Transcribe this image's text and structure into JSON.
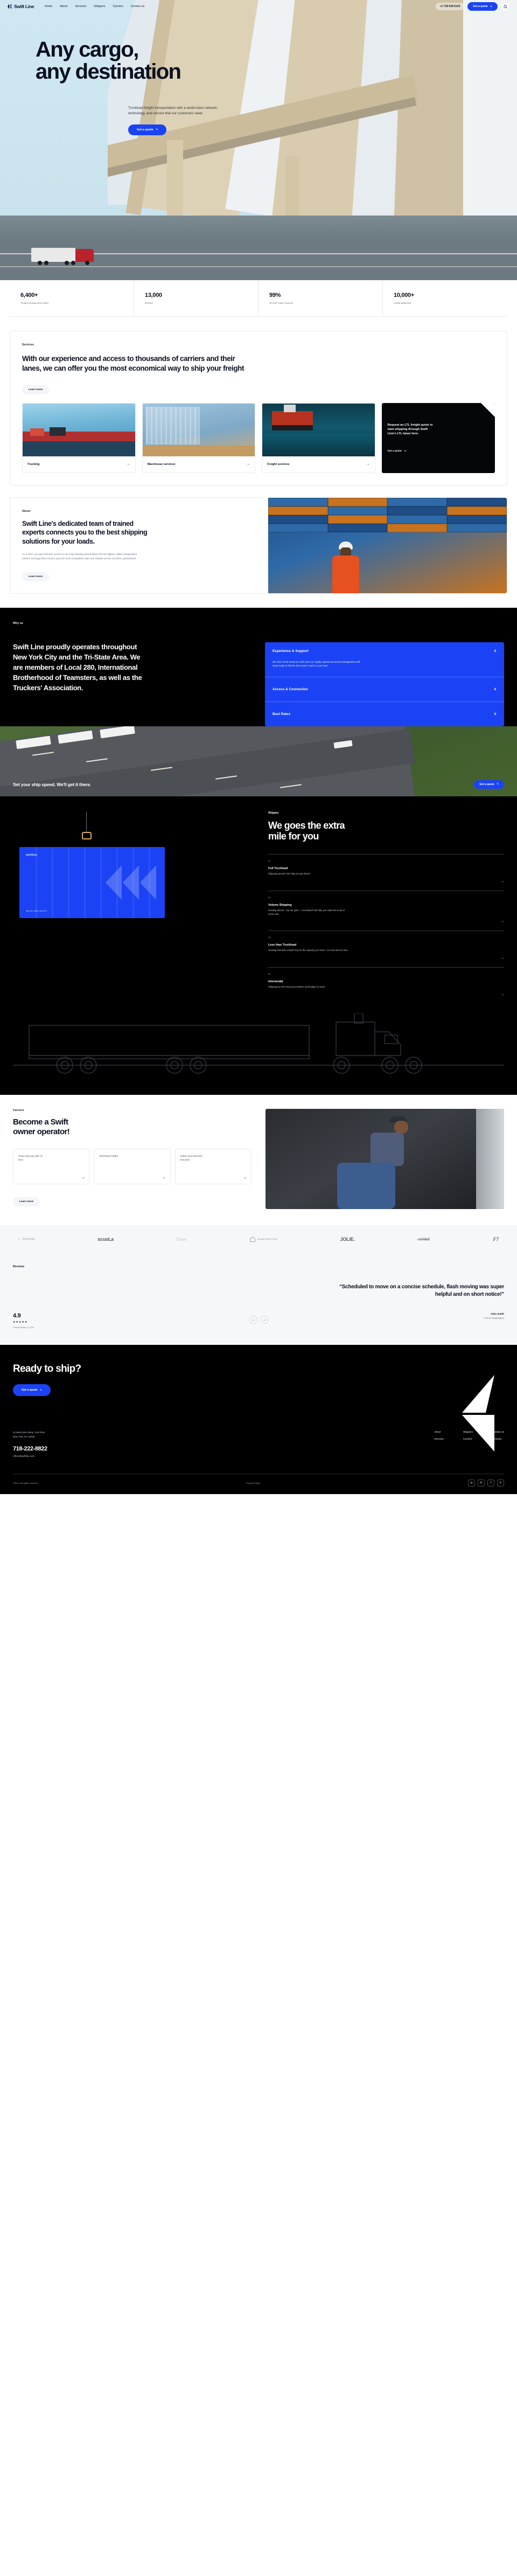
{
  "header": {
    "logo_text": "Swift Line",
    "nav": [
      {
        "label": "Home"
      },
      {
        "label": "About"
      },
      {
        "label": "Services"
      },
      {
        "label": "Shippers"
      },
      {
        "label": "Carriers"
      },
      {
        "label": "Contact us"
      }
    ],
    "phone": "+1 718 618 6133",
    "cta_label": "Get a quote",
    "cta_arrow": "↘",
    "search_icon": "search-icon"
  },
  "hero": {
    "title_line1": "Any cargo,",
    "title_line2": "any destination",
    "subtitle": "Truckload freight transportation with a world-class network, technology, and service that our customers need.",
    "cta_label": "Get a quote",
    "cta_arrow": "↘"
  },
  "stats": [
    {
      "value": "6,400+",
      "label": "Trailers produced in 2024"
    },
    {
      "value": "13,000",
      "label": "Drivers"
    },
    {
      "value": "99%",
      "label": "US ZIP code covered"
    },
    {
      "value": "10,000+",
      "label": "Loads delivered"
    }
  ],
  "services": {
    "eyebrow": "Services",
    "heading": "With our experience and access to thousands of carriers and their lanes, we can offer you the most economical way to ship your freight",
    "learn_more": "Learn more",
    "cards": [
      {
        "label": "Trucking",
        "arrow": "→"
      },
      {
        "label": "Warehouse services",
        "arrow": "→"
      },
      {
        "label": "Freight services",
        "arrow": "→"
      }
    ],
    "promo": {
      "text": "Request an LTL freight quote to start shipping through Swift Line's LTL lanes here.",
      "cta_label": "Get a quote",
      "cta_arrow": "↘"
    }
  },
  "about": {
    "eyebrow": "About",
    "heading": "Swift Line's dedicated team of trained experts connects you to the best shipping solutions for your loads.",
    "body": "As a client, you get exclusive access to our long-standing partnerships with the highest caliber independent carriers and large fleet carriers, plus the most competitive rates and reliable service out there, guaranteed!",
    "learn_more": "Learn more"
  },
  "why_us": {
    "eyebrow": "Why us",
    "heading": "Swift Line proudly operates throughout New York City and the Tri-State Area. We are members of Local 280, International Brotherhood of Teamsters, as well as the Truckers' Association.",
    "accordion": [
      {
        "title": "Experience & Support",
        "open": true,
        "body": "We view YOUR needs as OUR own! Our highly experienced and knowledgeable staff stand ready to find the best carrier match to your load.",
        "chevron": "∧"
      },
      {
        "title": "Access & Connection",
        "open": false,
        "body": "",
        "chevron": "∨"
      },
      {
        "title": "Best Rates",
        "open": false,
        "body": "",
        "chevron": "∨"
      }
    ],
    "banner_text": "Set your ship speed. We'll get it there.",
    "banner_cta": "Get a quote",
    "banner_cta_arrow": "↘"
  },
  "shippers": {
    "eyebrow": "Shippes",
    "title_line1": "We goes the extra",
    "title_line2": "mile for you",
    "container_label": "Swiftline",
    "container_code": "45G1 30 1\nSWFU 403 927 1",
    "items": [
      {
        "num": "01",
        "title": "Full Truckload",
        "desc": "Shipping ground? We help you get ahead.",
        "arrow": "→"
      },
      {
        "num": "02",
        "title": "Volume Shipping",
        "desc": "Sending almost – but not quite – a truckload? We help you make the most of every mile.",
        "arrow": "→"
      },
      {
        "num": "03",
        "title": "Less than Truckload",
        "desc": "Sending less than a load? Pay for the capacity you need – no more and no less.",
        "arrow": "→"
      },
      {
        "num": "04",
        "title": "Intermodal",
        "desc": "Shipping by rail? Keep your timeline and budget on track.",
        "arrow": "→"
      }
    ]
  },
  "carriers": {
    "eyebrow": "Carriers",
    "title_line1": "Become a Swift",
    "title_line2": "owner operator!",
    "benefits": [
      {
        "text": "Same day pay with no fees",
        "tick": "✓"
      },
      {
        "text": "Dedicated freight",
        "tick": "✓"
      },
      {
        "text": "Safety and retention bonuses",
        "tick": "✓"
      }
    ],
    "learn_more": "Learn more"
  },
  "logos": [
    {
      "name": "Tecnologia",
      "style": "t1",
      "mark": "◇"
    },
    {
      "name": "scuoLa",
      "style": "t2",
      "mark": ""
    },
    {
      "name": "Fiore",
      "style": "t3",
      "mark": ""
    },
    {
      "name": "KONSTRUKTION",
      "style": "t4",
      "mark": "house-icon"
    },
    {
      "name": "JOLIE.",
      "style": "t5",
      "mark": ""
    },
    {
      "name": "caridad.",
      "style": "t6",
      "mark": ""
    },
    {
      "name": "F7",
      "style": "t7",
      "mark": ""
    }
  ],
  "reviews": {
    "eyebrow": "Reviews",
    "quote": "“Scheduled to move on a concise schedule, flash moving was super helpful and on short notice!”",
    "rating": "4.9",
    "stars": "★★★★★",
    "rating_label": "Overall Rating  /1,219/",
    "prev_arrow": "←",
    "next_arrow": "→",
    "author_name": "John Smith",
    "author_role": "CTO of Konstruktion"
  },
  "footer": {
    "headline": "Ready to ship?",
    "cta_label": "Get a quote",
    "cta_arrow": "↘",
    "address_line1": "24 West 40st Street, 2nd Floor",
    "address_line2": "New York, NY 10036",
    "phone": "718-222-8822",
    "email": "office@swiftline.com",
    "columns": [
      {
        "links": [
          {
            "label": "About"
          },
          {
            "label": "Services"
          }
        ]
      },
      {
        "links": [
          {
            "label": "Shippers"
          },
          {
            "label": "Carriers"
          }
        ]
      },
      {
        "links": [
          {
            "label": "Contact us"
          },
          {
            "label": "Reviews"
          }
        ]
      }
    ],
    "copyright": "©2024. All rights reserved.",
    "privacy": "Privacy Policy",
    "socials": [
      {
        "icon": "instagram-icon",
        "glyph": "◎"
      },
      {
        "icon": "linkedin-icon",
        "glyph": "in"
      },
      {
        "icon": "facebook-icon",
        "glyph": "f"
      },
      {
        "icon": "x-icon",
        "glyph": "✕"
      }
    ]
  }
}
